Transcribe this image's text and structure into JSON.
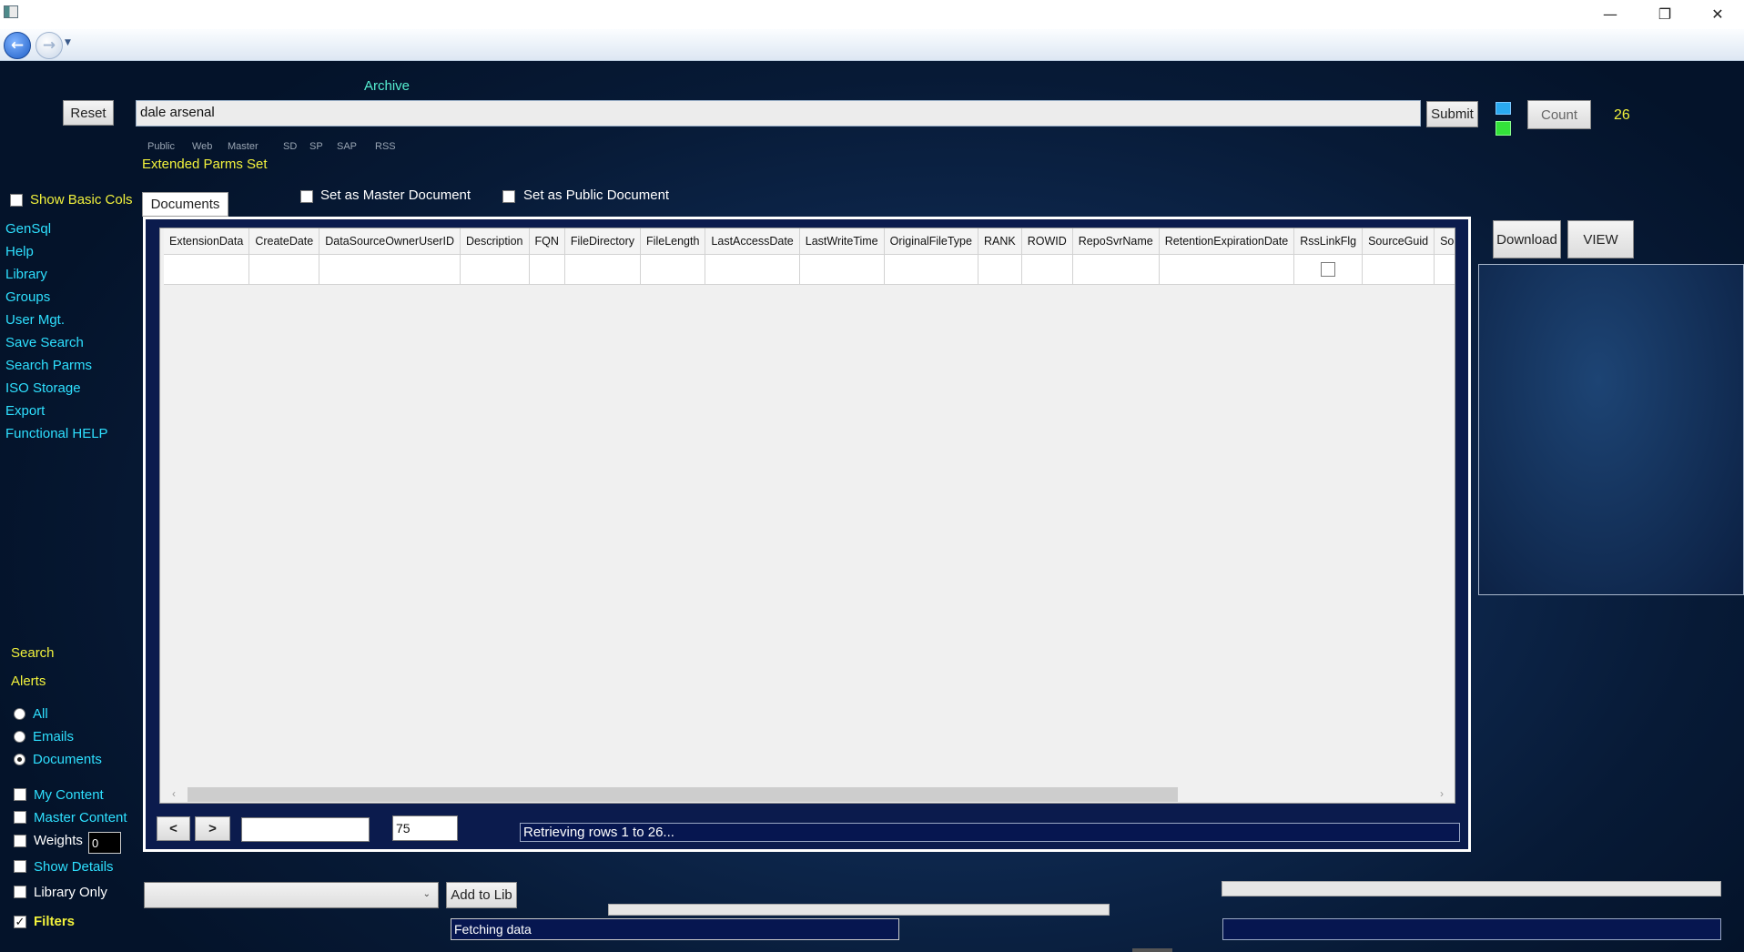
{
  "window": {
    "minimize_glyph": "—",
    "restore_glyph": "❐",
    "close_glyph": "✕"
  },
  "header": {
    "archive_label": "Archive",
    "reset_label": "Reset",
    "search_value": "dale arsenal",
    "submit_label": "Submit",
    "count_label": "Count",
    "count_value": "26",
    "source_tags": [
      "Public",
      "Web",
      "Master",
      "SD",
      "SP",
      "SAP",
      "RSS"
    ],
    "extended_parms": "Extended Parms Set",
    "indicator_colors": [
      "#2aa9f0",
      "#33e23a"
    ]
  },
  "options": {
    "show_basic_cols": "Show Basic Cols",
    "set_master": "Set as Master Document",
    "set_public": "Set as Public Document"
  },
  "tabs": {
    "documents": "Documents"
  },
  "sidebar": {
    "links": [
      "GenSql",
      "Help",
      "Library",
      "Groups",
      "User Mgt.",
      "Save Search",
      "Search Parms",
      "ISO Storage",
      "Export",
      "Functional HELP"
    ],
    "search_label": "Search",
    "alerts_label": "Alerts",
    "radios": [
      {
        "label": "All",
        "selected": false
      },
      {
        "label": "Emails",
        "selected": false
      },
      {
        "label": "Documents",
        "selected": true
      }
    ],
    "checks": {
      "my_content": "My Content",
      "master_content": "Master Content",
      "weights": "Weights",
      "weights_value": "0",
      "show_details": "Show Details",
      "library_only": "Library Only",
      "filters": "Filters"
    }
  },
  "grid": {
    "columns": [
      "ExtensionData",
      "CreateDate",
      "DataSourceOwnerUserID",
      "Description",
      "FQN",
      "FileDirectory",
      "FileLength",
      "LastAccessDate",
      "LastWriteTime",
      "OriginalFileType",
      "RANK",
      "ROWID",
      "RepoSvrName",
      "RetentionExpirationDate",
      "RssLinkFlg",
      "SourceGuid",
      "SourceNam"
    ]
  },
  "pager": {
    "prev": "<",
    "next": ">",
    "page_input": "",
    "page_size": "75",
    "status": "Retrieving rows 1 to 26..."
  },
  "right_panel": {
    "download_label": "Download",
    "view_label": "VIEW"
  },
  "bottom": {
    "library_select": "",
    "add_to_lib": "Add to Lib",
    "fetching": "Fetching data",
    "right_status": ""
  }
}
